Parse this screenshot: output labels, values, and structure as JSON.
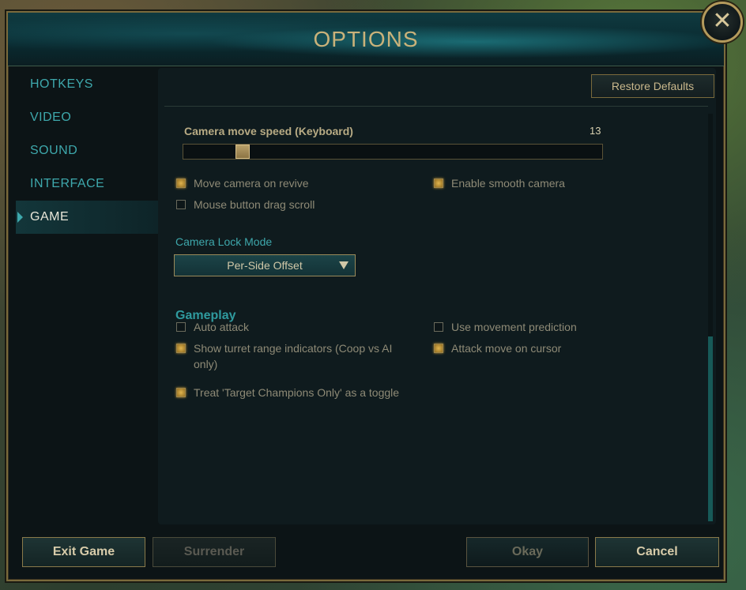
{
  "window": {
    "title": "OPTIONS",
    "close_symbol": "✕"
  },
  "sidebar": {
    "items": [
      {
        "label": "HOTKEYS"
      },
      {
        "label": "VIDEO"
      },
      {
        "label": "SOUND"
      },
      {
        "label": "INTERFACE"
      },
      {
        "label": "GAME",
        "active": true
      }
    ]
  },
  "content": {
    "restore_defaults_label": "Restore Defaults",
    "camera_speed": {
      "label": "Camera move speed (Keyboard)",
      "value": "13"
    },
    "checks": {
      "move_camera_on_revive": {
        "label": "Move camera on revive",
        "checked": true
      },
      "enable_smooth_camera": {
        "label": "Enable smooth camera",
        "checked": true
      },
      "mouse_drag_scroll": {
        "label": "Mouse button drag scroll",
        "checked": false
      }
    },
    "camera_lock": {
      "label": "Camera Lock Mode",
      "selected": "Per-Side Offset"
    },
    "gameplay": {
      "title": "Gameplay",
      "auto_attack": {
        "label": "Auto attack",
        "checked": false
      },
      "movement_prediction": {
        "label": "Use movement prediction",
        "checked": false
      },
      "turret_range": {
        "label": "Show turret range indicators (Coop vs AI only)",
        "checked": true
      },
      "attack_move_cursor": {
        "label": "Attack move on cursor",
        "checked": true
      },
      "target_champions_toggle": {
        "label": "Treat 'Target Champions Only' as a toggle",
        "checked": true
      }
    }
  },
  "footer": {
    "exit_label": "Exit Game",
    "surrender_label": "Surrender",
    "okay_label": "Okay",
    "cancel_label": "Cancel"
  },
  "colors": {
    "accent_teal": "#3ea8ac",
    "gold": "#c9b27a"
  }
}
